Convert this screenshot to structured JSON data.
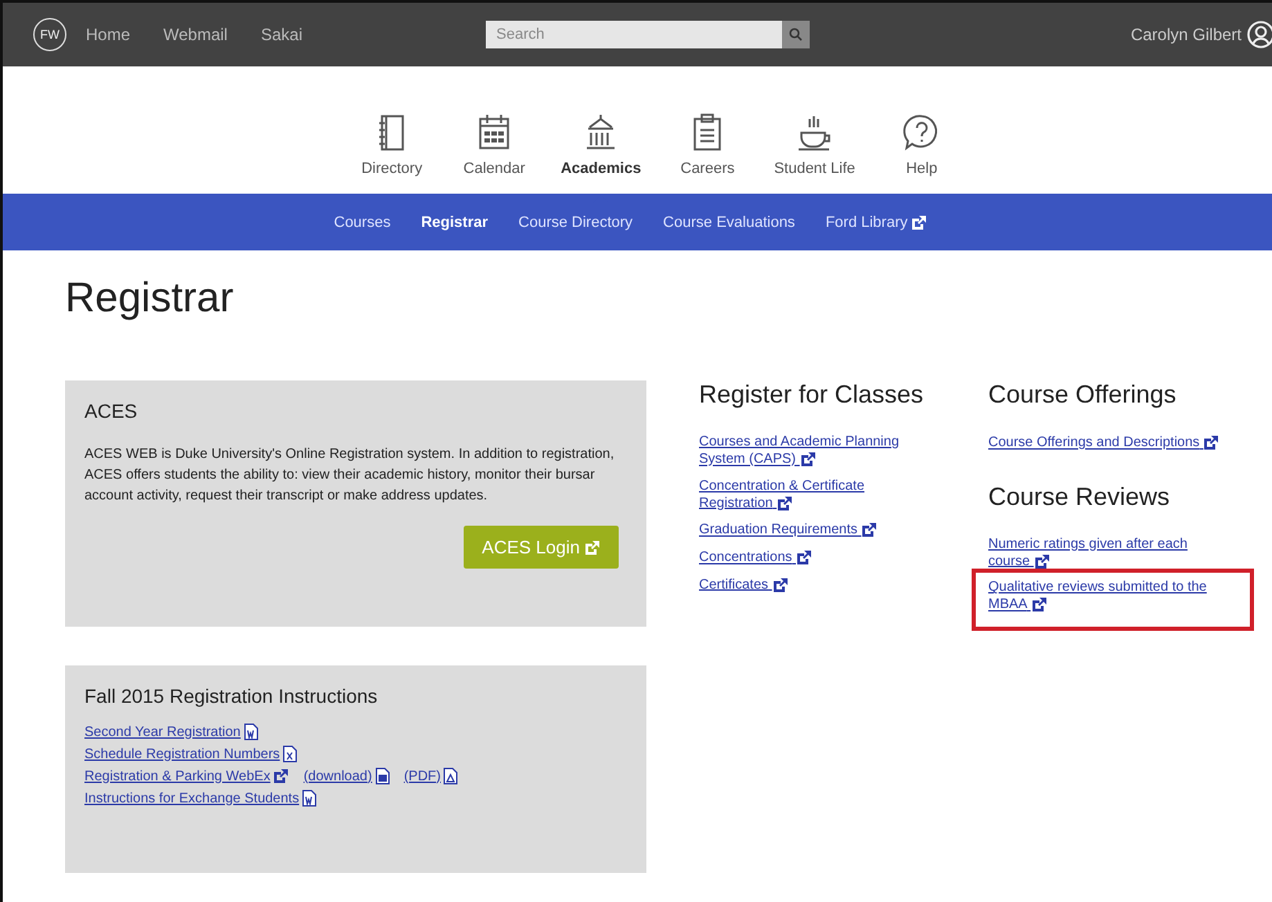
{
  "top_bar": {
    "logo": "FW",
    "links": [
      "Home",
      "Webmail",
      "Sakai"
    ],
    "search": {
      "placeholder": "Search"
    },
    "user": "Carolyn Gilbert"
  },
  "main_nav": [
    {
      "label": "Directory",
      "kind": "book",
      "selected": false
    },
    {
      "label": "Calendar",
      "kind": "calendar",
      "selected": false
    },
    {
      "label": "Academics",
      "kind": "building",
      "selected": true
    },
    {
      "label": "Careers",
      "kind": "clipboard",
      "selected": false
    },
    {
      "label": "Student Life",
      "kind": "cup",
      "selected": false
    },
    {
      "label": "Help",
      "kind": "help",
      "selected": false
    }
  ],
  "sub_nav": [
    {
      "label": "Courses",
      "selected": false,
      "external": false
    },
    {
      "label": "Registrar",
      "selected": true,
      "external": false
    },
    {
      "label": "Course Directory",
      "selected": false,
      "external": false
    },
    {
      "label": "Course Evaluations",
      "selected": false,
      "external": false
    },
    {
      "label": "Ford Library",
      "selected": false,
      "external": true
    }
  ],
  "page_title": "Registrar",
  "aces": {
    "title": "ACES",
    "text": "ACES WEB is Duke University's Online Registration system. In addition to registration, ACES offers students the ability to: view their academic history, monitor their bursar account activity, request their transcript or make address updates.",
    "button": "ACES Login"
  },
  "instructions": {
    "title": "Fall 2015 Registration Instructions",
    "lines": [
      [
        {
          "text": "Second Year Registration",
          "kind": "word"
        }
      ],
      [
        {
          "text": "Schedule Registration Numbers",
          "kind": "excel"
        }
      ],
      [
        {
          "text": "Registration & Parking WebEx",
          "kind": "external"
        },
        {
          "text": "(download)",
          "kind": "file"
        },
        {
          "text": "(PDF)",
          "kind": "pdf"
        }
      ],
      [
        {
          "text": "Instructions for Exchange Students",
          "kind": "word"
        }
      ]
    ]
  },
  "columns": [
    {
      "sections": [
        {
          "title": "Register for Classes",
          "links": [
            {
              "text": "Courses and Academic Planning System (CAPS)",
              "highlighted": false
            },
            {
              "text": "Concentration & Certificate Registration",
              "highlighted": false
            },
            {
              "text": "Graduation Requirements",
              "highlighted": false
            },
            {
              "text": "Concentrations",
              "highlighted": false
            },
            {
              "text": "Certificates",
              "highlighted": false
            }
          ]
        }
      ]
    },
    {
      "sections": [
        {
          "title": "Course Offerings",
          "links": [
            {
              "text": "Course Offerings and Descriptions",
              "highlighted": false
            }
          ]
        },
        {
          "title": "Course Reviews",
          "links": [
            {
              "text": "Numeric ratings given after each course",
              "highlighted": false
            },
            {
              "text": "Qualitative reviews submitted to the MBAA",
              "highlighted": true
            }
          ]
        }
      ]
    }
  ]
}
